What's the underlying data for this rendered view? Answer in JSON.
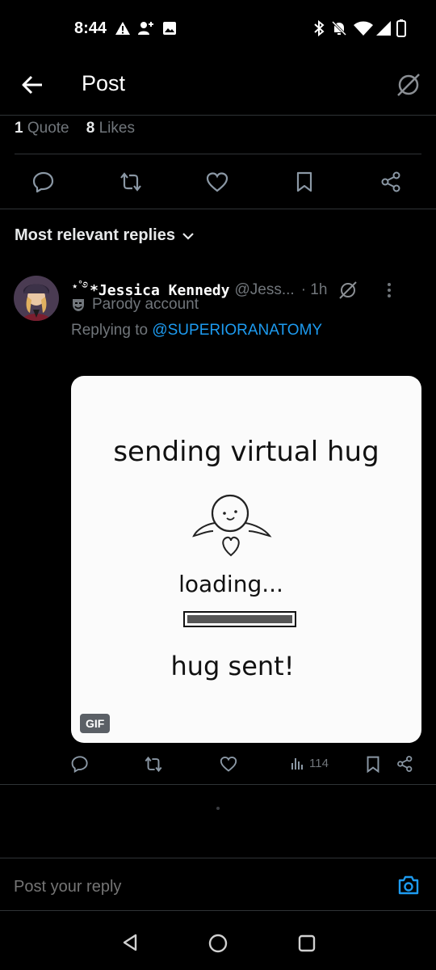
{
  "status_bar": {
    "time": "8:44",
    "left_icons": [
      "alert-icon",
      "person-add-icon",
      "image-icon"
    ],
    "right_icons": [
      "bluetooth-icon",
      "bell-off-icon",
      "wifi-icon",
      "signal-icon",
      "battery-icon"
    ]
  },
  "header": {
    "title": "Post",
    "back_icon": "arrow-left-icon",
    "grok_icon": "grok-icon"
  },
  "stats": {
    "quote_count": "1",
    "quote_label": "Quote",
    "like_count": "8",
    "like_label": "Likes"
  },
  "replies_filter": {
    "label": "Most relevant replies"
  },
  "reply": {
    "name_prefix": "⋆˚࿔",
    "author_name": "*Jessica Kennedy",
    "handle": "@Jess...",
    "time": "· 1h",
    "parody_label": "Parody account",
    "replying_prefix": "Replying to",
    "replying_to": "@SUPERIORANATOMY",
    "gif_badge": "GIF",
    "gif": {
      "line1": "sending virtual hug",
      "line2": "loading...",
      "line3": "hug sent!"
    },
    "views": "114"
  },
  "composer": {
    "placeholder": "Post your reply"
  },
  "colors": {
    "background": "#000000",
    "text": "#e7e9ea",
    "muted": "#71767b",
    "link": "#1d9bf0",
    "divider": "#2f3336"
  }
}
